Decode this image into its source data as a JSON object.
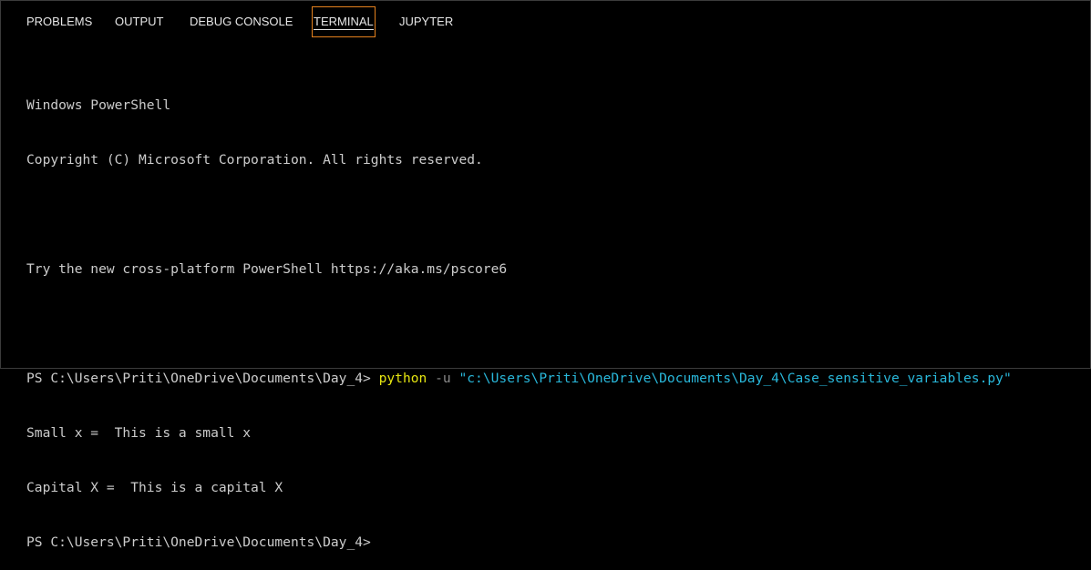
{
  "panel": {
    "tabs": [
      {
        "label": "PROBLEMS"
      },
      {
        "label": "OUTPUT"
      },
      {
        "label": "DEBUG CONSOLE"
      },
      {
        "label": "TERMINAL",
        "active": true
      },
      {
        "label": "JUPYTER"
      }
    ]
  },
  "terminal": {
    "banner_title": "Windows PowerShell",
    "banner_copyright": "Copyright (C) Microsoft Corporation. All rights reserved.",
    "banner_tip": "Try the new cross-platform PowerShell https://aka.ms/pscore6",
    "prompt": "PS C:\\Users\\Priti\\OneDrive\\Documents\\Day_4> ",
    "command": {
      "program": "python",
      "flag": "-u",
      "path": "\"c:\\Users\\Priti\\OneDrive\\Documents\\Day_4\\Case_sensitive_variables.py\""
    },
    "output": [
      "Small x =  This is a small x",
      "Capital X =  This is a capital X"
    ],
    "final_prompt": "PS C:\\Users\\Priti\\OneDrive\\Documents\\Day_4>"
  },
  "colors": {
    "background": "#000000",
    "text": "#cccccc",
    "command": "#e5e510",
    "flag": "#8a8a8a",
    "string": "#29b8db",
    "active_tab_border": "#e5811d"
  }
}
